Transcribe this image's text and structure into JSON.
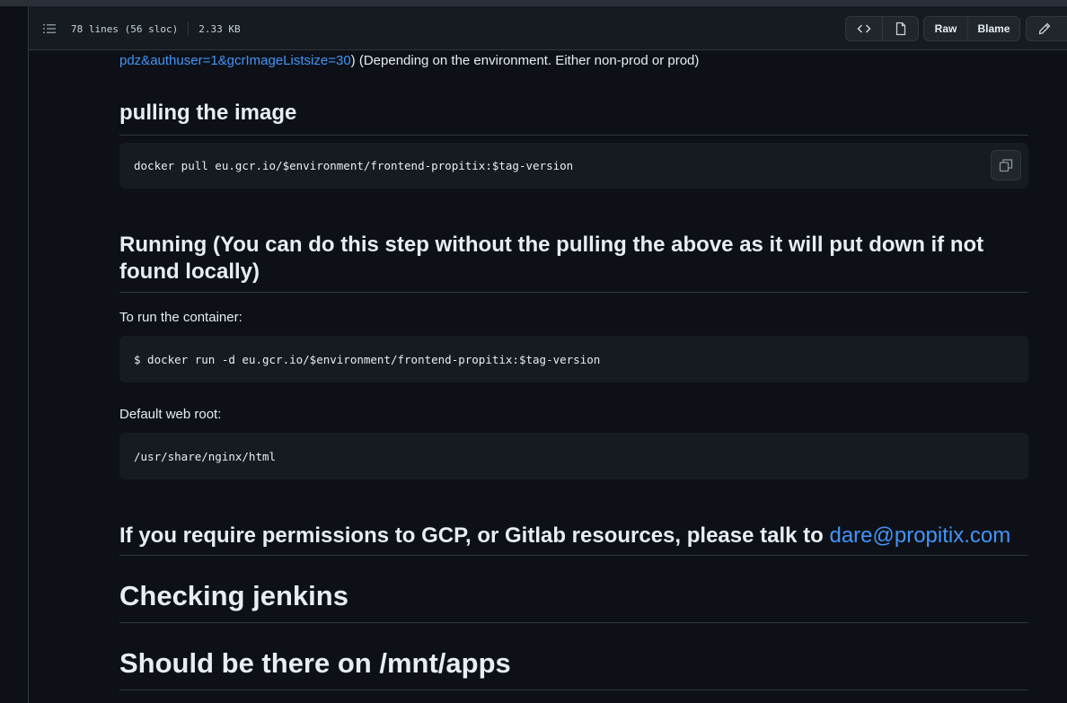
{
  "file_header": {
    "lines": "78 lines (56 sloc)",
    "size": "2.33 KB",
    "raw_label": "Raw",
    "blame_label": "Blame"
  },
  "content": {
    "link_fragment": "pdz&authuser=1&gcrImageListsize=30",
    "link_tail": ") (Depending on the environment. Either non-prod or prod)",
    "h_pull": "pulling the image",
    "code_pull": "docker pull eu.gcr.io/$environment/frontend-propitix:$tag-version",
    "h_running": "Running (You can do this step without the pulling the above as it will put down if not found locally)",
    "p_run": "To run the container:",
    "code_run": "$ docker run -d eu.gcr.io/$environment/frontend-propitix:$tag-version",
    "p_webroot": "Default web root:",
    "code_webroot": "/usr/share/nginx/html",
    "h_perm_text": "If you require permissions to GCP, or Gitlab resources, please talk to ",
    "h_perm_link": "dare@propitix.com",
    "h_jenkins": "Checking jenkins",
    "h_apps": "Should be there on /mnt/apps"
  },
  "icons": [
    "list-icon",
    "code-icon",
    "file-icon",
    "pencil-icon",
    "copy-icon"
  ],
  "colors": {
    "background": "#0d1117",
    "panel": "#161b22",
    "link": "#4493f8",
    "border": "#30363d"
  }
}
